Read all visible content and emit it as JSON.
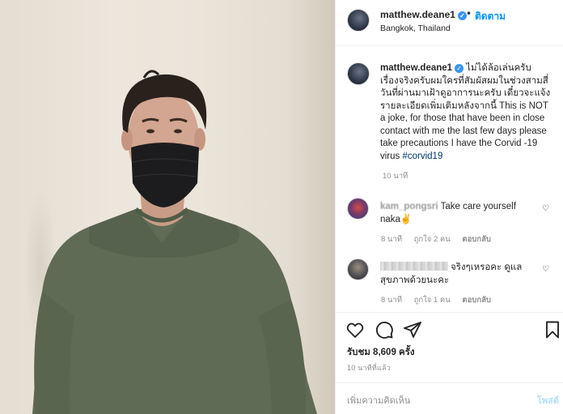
{
  "post": {
    "photo_alt": "",
    "author": {
      "username": "matthew.deane1",
      "verified": true,
      "follow_label": "ติดตาม",
      "location": "Bangkok, Thailand"
    },
    "caption": {
      "username": "matthew.deane1",
      "text": "ไม่ได้ล้อเล่นครับ เรื่องจริงครับผมใครที่สัมผัสผมในช่วงสามสี่วันที่ผ่านมาเฝ้าดูอาการนะครับ เดี๋ยวจะแจ้งรายละเอียดเพิ่มเติมหลังจากนี้ This is NOT a joke, for those that have been in close contact with me the last few days please take precautions I have the Corvid -19 virus",
      "hashtag": "#corvid19",
      "time": "10 นาที"
    },
    "comments": [
      {
        "username": "kam_pongsri",
        "text": "Take care yourself naka✌",
        "time": "8 นาที",
        "likes": "ถูกใจ 2 คน",
        "reply_label": "ตอบกลับ"
      },
      {
        "username": "",
        "text": "จริงๆเหรอคะ ดูแลสุขภาพด้วยนะคะ",
        "time": "8 นาที",
        "likes": "ถูกใจ 1 คน",
        "reply_label": "ตอบกลับ"
      }
    ],
    "views": "รับชม 8,609 ครั้ง",
    "posted_ago": "10 นาทีที่แล้ว",
    "add_comment_placeholder": "เพิ่มความคิดเห็น",
    "post_button_label": "โพสต์"
  },
  "icons": {
    "verified": "verified-badge-icon",
    "more": "more-options-icon",
    "heart": "heart-icon",
    "comment": "comment-icon",
    "share": "share-icon",
    "bookmark": "bookmark-icon"
  },
  "colors": {
    "link_blue": "#0095f6",
    "hashtag": "#00376b",
    "muted": "#8e8e8e",
    "post_disabled": "#b2dffc"
  }
}
